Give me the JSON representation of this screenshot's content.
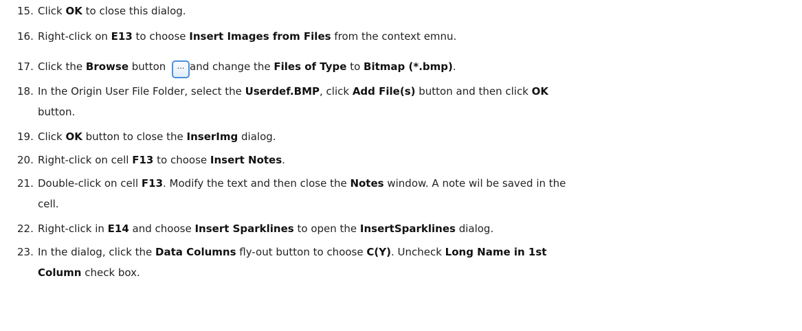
{
  "steps": [
    {
      "num": "15.",
      "parts": [
        "Click ",
        "OK",
        " to close this dialog."
      ]
    },
    {
      "num": "16.",
      "parts": [
        "Right-click on ",
        "E13",
        " to choose ",
        "Insert Images from Files",
        " from the context emnu."
      ]
    },
    {
      "num": "17.",
      "parts": [
        "Click the ",
        "Browse",
        " button ",
        "and change the ",
        "Files of Type",
        " to ",
        "Bitmap (*.bmp)",
        "."
      ],
      "button_glyph": "…"
    },
    {
      "num": "18.",
      "line1": [
        "In the Origin User File Folder, select the ",
        "Userdef.BMP",
        ", click ",
        "Add File(s)",
        " button and then click ",
        "OK"
      ],
      "line2": [
        "button."
      ]
    },
    {
      "num": "19.",
      "parts": [
        "Click ",
        "OK",
        " button to close the ",
        "InserImg",
        " dialog."
      ]
    },
    {
      "num": "20.",
      "parts": [
        "Right-click on cell ",
        "F13",
        " to choose ",
        "Insert Notes",
        "."
      ]
    },
    {
      "num": "21.",
      "line1": [
        "Double-click on cell ",
        "F13",
        ". Modify the text and then close the ",
        "Notes",
        " window. A note wil be saved in the"
      ],
      "line2": [
        "cell."
      ]
    },
    {
      "num": "22.",
      "parts": [
        "Right-click in ",
        "E14",
        " and choose ",
        "Insert Sparklines",
        " to open the ",
        "InsertSparklines",
        " dialog."
      ]
    },
    {
      "num": "23.",
      "line1": [
        "In the dialog, click the ",
        "Data Columns",
        " fly-out button to choose ",
        "C(Y)",
        ". Uncheck ",
        "Long Name in 1st"
      ],
      "line2": [
        "Column",
        " check box."
      ]
    }
  ]
}
